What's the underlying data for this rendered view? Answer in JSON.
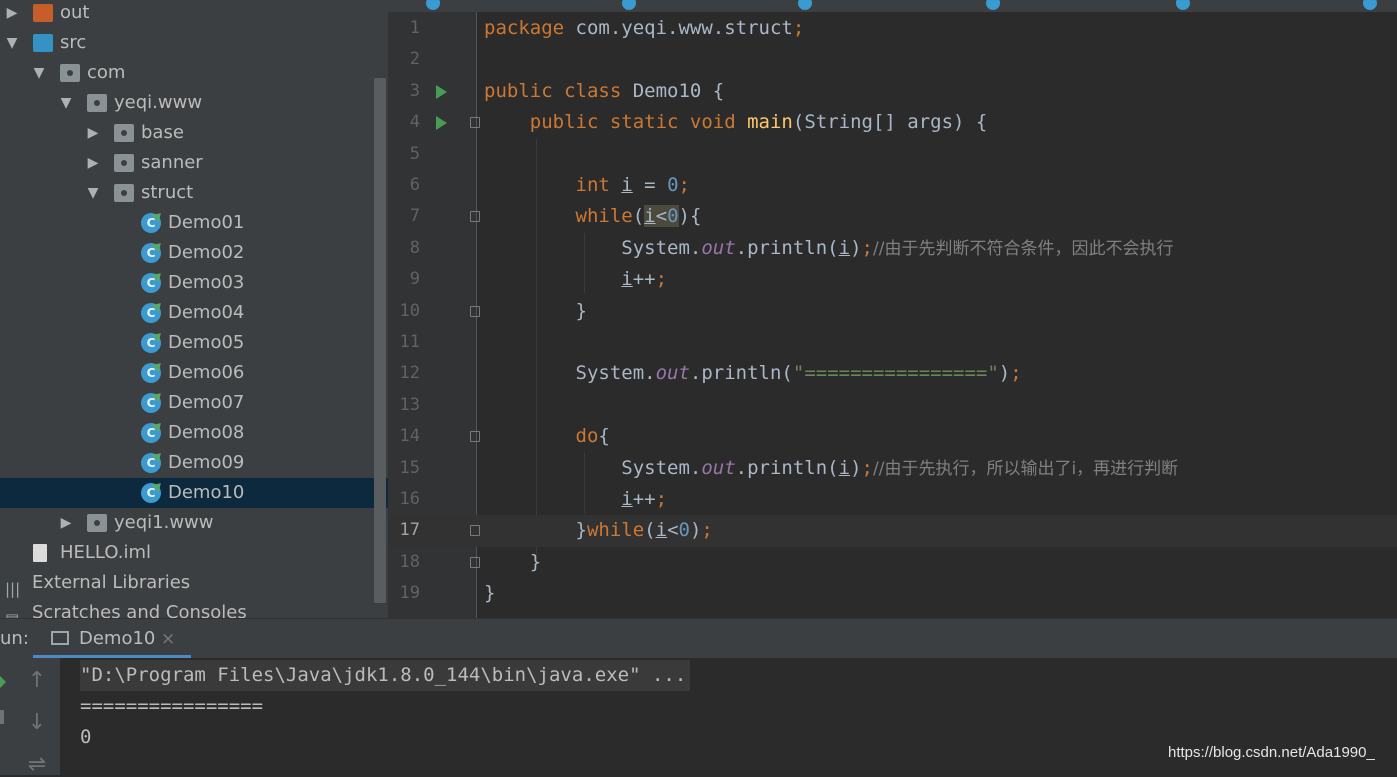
{
  "colors": {
    "background": "#2b2b2b",
    "panel": "#3c3f41",
    "selection": "#0d293e",
    "keyword": "#cc7832",
    "function": "#ffc66d",
    "number": "#6897bb",
    "string": "#6a8759",
    "static_field": "#9876aa",
    "comment": "#808080",
    "run_tab_underline": "#4a88c7"
  },
  "project_tree": {
    "items": [
      {
        "label": "out",
        "icon": "folder-orange-icon",
        "arrow": "▶"
      },
      {
        "label": "src",
        "icon": "folder-blue-icon",
        "arrow": "▼"
      },
      {
        "label": "com",
        "icon": "package-icon",
        "arrow": "▼"
      },
      {
        "label": "yeqi.www",
        "icon": "package-icon",
        "arrow": "▼"
      },
      {
        "label": "base",
        "icon": "package-icon",
        "arrow": "▶"
      },
      {
        "label": "sanner",
        "icon": "package-icon",
        "arrow": "▶"
      },
      {
        "label": "struct",
        "icon": "package-icon",
        "arrow": "▼"
      },
      {
        "label": "Demo01",
        "icon": "java-class-icon"
      },
      {
        "label": "Demo02",
        "icon": "java-class-icon"
      },
      {
        "label": "Demo03",
        "icon": "java-class-icon"
      },
      {
        "label": "Demo04",
        "icon": "java-class-icon"
      },
      {
        "label": "Demo05",
        "icon": "java-class-icon"
      },
      {
        "label": "Demo06",
        "icon": "java-class-icon"
      },
      {
        "label": "Demo07",
        "icon": "java-class-icon"
      },
      {
        "label": "Demo08",
        "icon": "java-class-icon"
      },
      {
        "label": "Demo09",
        "icon": "java-class-icon"
      },
      {
        "label": "Demo10",
        "icon": "java-class-icon",
        "selected": true
      },
      {
        "label": "yeqi1.www",
        "icon": "package-icon",
        "arrow": "▶"
      },
      {
        "label": "HELLO.iml",
        "icon": "iml-file-icon"
      },
      {
        "label": "External Libraries",
        "icon": "libraries-icon"
      },
      {
        "label": "Scratches and Consoles",
        "icon": "scratches-icon"
      }
    ]
  },
  "editor": {
    "current_line": 17,
    "lines": [
      {
        "n": "1",
        "tokens": [
          [
            "kw",
            "package "
          ],
          [
            "",
            "com.yeqi.www.struct"
          ],
          [
            "kw",
            ";"
          ]
        ]
      },
      {
        "n": "2",
        "tokens": []
      },
      {
        "n": "3",
        "run": true,
        "tokens": [
          [
            "kw",
            "public class "
          ],
          [
            "",
            "Demo10 {"
          ]
        ]
      },
      {
        "n": "4",
        "run": true,
        "fold": true,
        "tokens": [
          [
            "",
            "    "
          ],
          [
            "kw",
            "public static void "
          ],
          [
            "fn",
            "main"
          ],
          [
            "",
            "(String[] args) {"
          ]
        ]
      },
      {
        "n": "5",
        "tokens": []
      },
      {
        "n": "6",
        "tokens": [
          [
            "",
            "        "
          ],
          [
            "kw",
            "int "
          ],
          [
            "var",
            "i"
          ],
          [
            "",
            " = "
          ],
          [
            "num",
            "0"
          ],
          [
            "kw",
            ";"
          ]
        ]
      },
      {
        "n": "7",
        "fold": true,
        "tokens": [
          [
            "",
            "        "
          ],
          [
            "kw",
            "while"
          ],
          [
            "",
            "("
          ],
          [
            "var hl",
            "i"
          ],
          [
            "hl",
            "<"
          ],
          [
            "num hl",
            "0"
          ],
          [
            "",
            "){"
          ]
        ]
      },
      {
        "n": "8",
        "tokens": [
          [
            "",
            "            System."
          ],
          [
            "st",
            "out"
          ],
          [
            "",
            ".println("
          ],
          [
            "var",
            "i"
          ],
          [
            "",
            ")"
          ],
          [
            "kw",
            ";"
          ],
          [
            "cm",
            "//由于先判断不符合条件，因此不会执行"
          ]
        ]
      },
      {
        "n": "9",
        "tokens": [
          [
            "",
            "            "
          ],
          [
            "var",
            "i"
          ],
          [
            "",
            "++"
          ],
          [
            "kw",
            ";"
          ]
        ]
      },
      {
        "n": "10",
        "fold": true,
        "tokens": [
          [
            "",
            "        }"
          ]
        ]
      },
      {
        "n": "11",
        "tokens": []
      },
      {
        "n": "12",
        "tokens": [
          [
            "",
            "        System."
          ],
          [
            "st",
            "out"
          ],
          [
            "",
            ".println("
          ],
          [
            "str",
            "\"================\""
          ],
          [
            "",
            ")"
          ],
          [
            "kw",
            ";"
          ]
        ]
      },
      {
        "n": "13",
        "tokens": []
      },
      {
        "n": "14",
        "fold": true,
        "tokens": [
          [
            "",
            "        "
          ],
          [
            "kw",
            "do"
          ],
          [
            "",
            "{"
          ]
        ]
      },
      {
        "n": "15",
        "tokens": [
          [
            "",
            "            System."
          ],
          [
            "st",
            "out"
          ],
          [
            "",
            ".println("
          ],
          [
            "var",
            "i"
          ],
          [
            "",
            ")"
          ],
          [
            "kw",
            ";"
          ],
          [
            "cm",
            "//由于先执行，所以输出了i，再进行判断"
          ]
        ]
      },
      {
        "n": "16",
        "tokens": [
          [
            "",
            "            "
          ],
          [
            "var",
            "i"
          ],
          [
            "",
            "++"
          ],
          [
            "kw",
            ";"
          ]
        ]
      },
      {
        "n": "17",
        "fold": true,
        "tokens": [
          [
            "",
            "        }"
          ],
          [
            "kw",
            "while"
          ],
          [
            "",
            "("
          ],
          [
            "var",
            "i"
          ],
          [
            "",
            "<"
          ],
          [
            "num",
            "0"
          ],
          [
            "",
            ")"
          ],
          [
            "kw",
            ";"
          ]
        ]
      },
      {
        "n": "18",
        "fold": true,
        "tokens": [
          [
            "",
            "    }"
          ]
        ]
      },
      {
        "n": "19",
        "tokens": [
          [
            "",
            "}"
          ]
        ]
      }
    ]
  },
  "run_panel": {
    "label": "un:",
    "tab_label": "Demo10",
    "close_glyph": "×",
    "toolbar_icons": [
      {
        "name": "up-arrow-icon",
        "glyph": "↑"
      },
      {
        "name": "down-arrow-icon",
        "glyph": "↓"
      },
      {
        "name": "soft-wrap-icon",
        "glyph": "⇌"
      }
    ],
    "console_lines": [
      "\"D:\\Program Files\\Java\\jdk1.8.0_144\\bin\\java.exe\" ...",
      "================",
      "0"
    ]
  },
  "watermark": "https://blog.csdn.net/Ada1990_"
}
